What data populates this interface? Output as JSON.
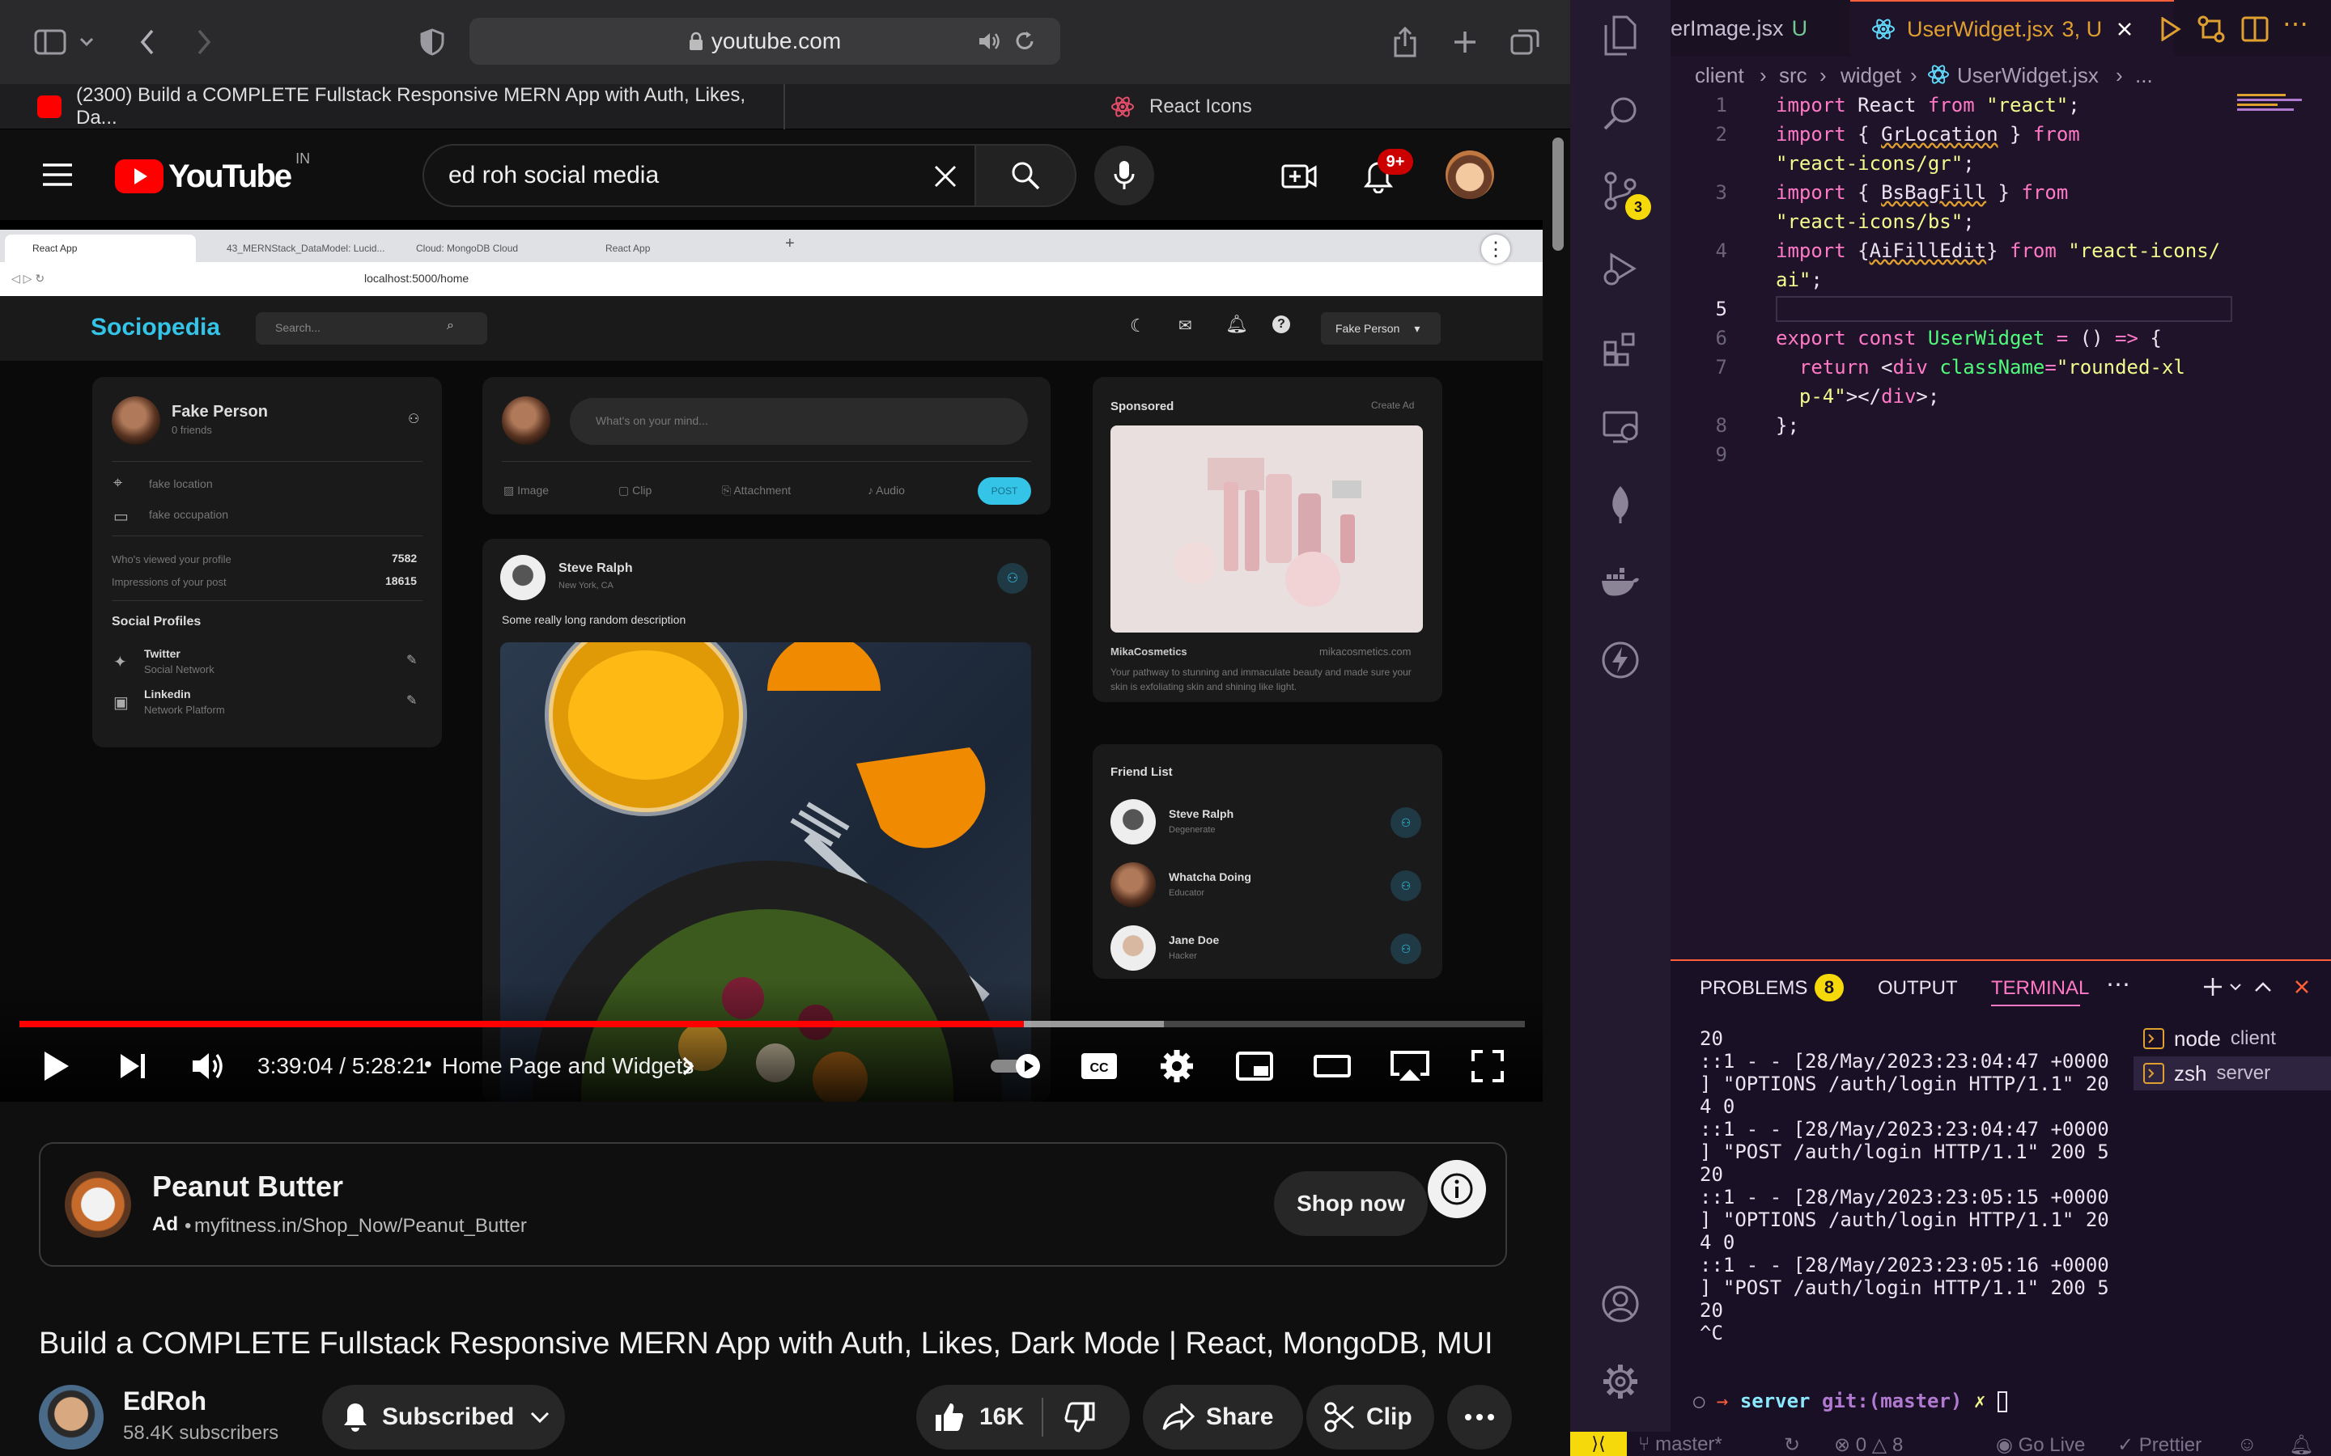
{
  "safari": {
    "url": "youtube.com",
    "tabs": [
      {
        "label": "(2300) Build a COMPLETE Fullstack Responsive MERN App with Auth, Likes, Da..."
      },
      {
        "label": "React Icons"
      }
    ]
  },
  "youtube": {
    "logo_text": "YouTube",
    "region": "IN",
    "search_value": "ed roh social media",
    "notifications_badge": "9+",
    "video": {
      "browser_tabs": [
        "React App",
        "43_MERNStack_DataModel: Lucid...",
        "Cloud: MongoDB Cloud",
        "React App"
      ],
      "browser_url": "localhost:5000/home",
      "app": {
        "brand": "Sociopedia",
        "search_placeholder": "Search...",
        "user_menu": "Fake Person",
        "profile": {
          "name": "Fake Person",
          "friends": "0 friends",
          "location": "fake location",
          "occupation": "fake occupation",
          "viewed_label": "Who's viewed your profile",
          "viewed_value": "7582",
          "impressions_label": "Impressions of your post",
          "impressions_value": "18615",
          "social_title": "Social Profiles",
          "socials": [
            {
              "name": "Twitter",
              "type": "Social Network"
            },
            {
              "name": "Linkedin",
              "type": "Network Platform"
            }
          ]
        },
        "composer": {
          "placeholder": "What's on your mind...",
          "actions": [
            "Image",
            "Clip",
            "Attachment",
            "Audio"
          ],
          "post_label": "POST"
        },
        "post": {
          "author": "Steve Ralph",
          "location": "New York, CA",
          "description": "Some really long random description"
        },
        "sponsored": {
          "title": "Sponsored",
          "create_ad": "Create Ad",
          "brand": "MikaCosmetics",
          "site": "mikacosmetics.com",
          "text": "Your pathway to stunning and immaculate beauty and made sure your skin is exfoliating skin and shining like light."
        },
        "friend_list": {
          "title": "Friend List",
          "friends": [
            {
              "name": "Steve Ralph",
              "role": "Degenerate"
            },
            {
              "name": "Whatcha Doing",
              "role": "Educator"
            },
            {
              "name": "Jane Doe",
              "role": "Hacker"
            }
          ]
        }
      },
      "time": "3:39:04 / 5:28:21",
      "chapter": "Home Page and Widgets",
      "progress": 0.667,
      "buffered": 0.76
    },
    "ad": {
      "title": "Peanut Butter",
      "label": "Ad",
      "url": "myfitness.in/Shop_Now/Peanut_Butter",
      "cta": "Shop now"
    },
    "title": "Build a COMPLETE Fullstack Responsive MERN App with Auth, Likes, Dark Mode | React, MongoDB, MUI",
    "channel": {
      "name": "EdRoh",
      "subscribers": "58.4K subscribers"
    },
    "subscribed_label": "Subscribed",
    "likes": "16K",
    "share_label": "Share",
    "clip_label": "Clip"
  },
  "vscode": {
    "tabs": [
      {
        "label": "erImage.jsx",
        "status": "U"
      },
      {
        "label": "UserWidget.jsx",
        "status": "3, U"
      }
    ],
    "breadcrumb": [
      "client",
      "src",
      "widget",
      "UserWidget.jsx",
      "..."
    ],
    "scm_badge": "3",
    "code_lines": [
      "1",
      "2",
      "",
      "3",
      "",
      "4",
      "",
      "5",
      "6",
      "7",
      "",
      "8",
      "9"
    ],
    "panel_tabs": {
      "problems": "PROBLEMS",
      "problems_count": "8",
      "output": "OUTPUT",
      "terminal": "TERMINAL"
    },
    "terminals": [
      {
        "shell": "node",
        "name": "client"
      },
      {
        "shell": "zsh",
        "name": "server"
      }
    ],
    "terminal_lines": [
      "20",
      "::1 - - [28/May/2023:23:04:47 +0000",
      "] \"OPTIONS /auth/login HTTP/1.1\" 20",
      "4 0",
      "::1 - - [28/May/2023:23:04:47 +0000",
      "] \"POST /auth/login HTTP/1.1\" 200 5",
      "20",
      "::1 - - [28/May/2023:23:05:15 +0000",
      "] \"OPTIONS /auth/login HTTP/1.1\" 20",
      "4 0",
      "::1 - - [28/May/2023:23:05:16 +0000",
      "] \"POST /auth/login HTTP/1.1\" 200 5",
      "20",
      "^C"
    ],
    "prompt": {
      "dir": "server",
      "branch_label": "git:(master)",
      "mark": "✗"
    },
    "status": {
      "branch": "master*",
      "errors": "0",
      "warnings": "8",
      "golive": "Go Live",
      "prettier": "Prettier"
    }
  },
  "colors": {
    "yt_red": "#ff0000",
    "accent": "#3ea6ff",
    "vscode_accent": "#ff5e3a"
  }
}
